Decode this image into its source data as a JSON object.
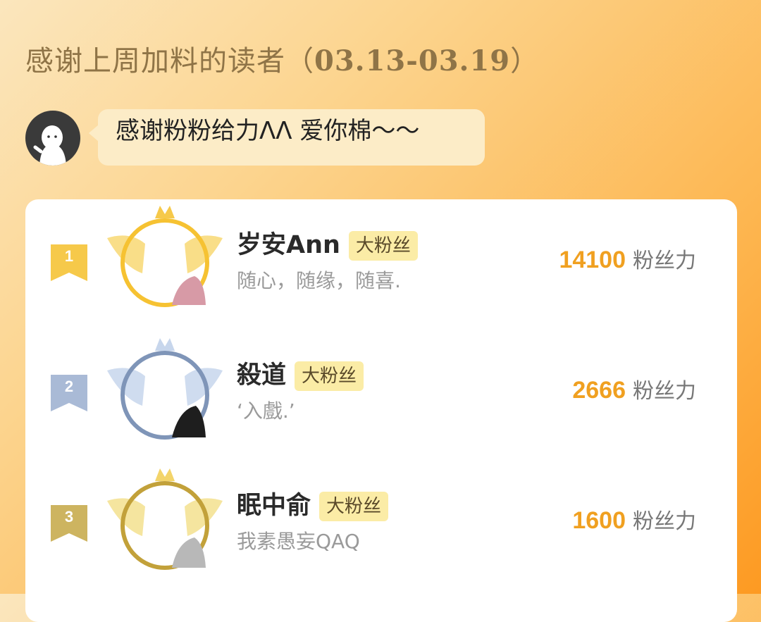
{
  "header": {
    "title_prefix": "感谢上周加料的读者（",
    "date_range": "03.13-03.19",
    "title_suffix": "）"
  },
  "message": {
    "text": "感谢粉粉给力ᐱᐱ 爱你棉～～",
    "avatar_icon": "ghost-avatar-icon"
  },
  "leaderboard": [
    {
      "rank": "1",
      "name": "岁安Ann",
      "tag": "大粉丝",
      "motto": "随心，随缘，随喜.",
      "score": "14100",
      "score_unit": "粉丝力",
      "frame_color": "#f6c232"
    },
    {
      "rank": "2",
      "name": "殺道",
      "tag": "大粉丝",
      "motto": "‘入戲.’",
      "score": "2666",
      "score_unit": "粉丝力",
      "frame_color": "#7f95b8"
    },
    {
      "rank": "3",
      "name": "眠中俞",
      "tag": "大粉丝",
      "motto": "我素愚妄QAQ",
      "score": "1600",
      "score_unit": "粉丝力",
      "frame_color": "#c2a13a"
    }
  ],
  "colors": {
    "accent": "#f0a020",
    "gold": "#f6c232",
    "silver": "#7f95b8",
    "bronze": "#c2a13a"
  }
}
